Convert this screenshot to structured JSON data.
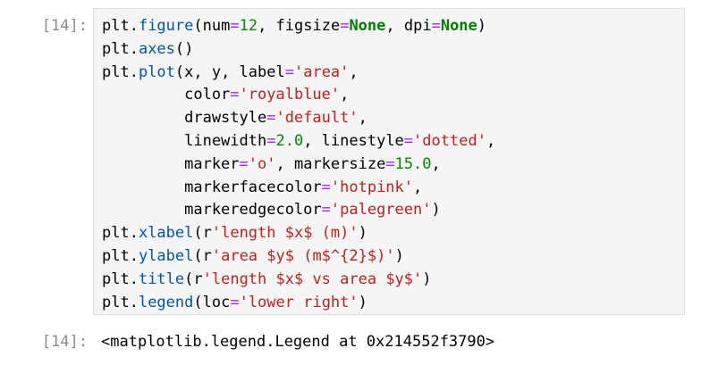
{
  "cell": {
    "input_prompt": "[14]:",
    "output_prompt": "[14]:",
    "output_text": "<matplotlib.legend.Legend at 0x214552f3790>",
    "code_lines": [
      [
        {
          "t": "plt.",
          "c": ""
        },
        {
          "t": "figure",
          "c": "k-func"
        },
        {
          "t": "(num",
          "c": ""
        },
        {
          "t": "=",
          "c": "k-op"
        },
        {
          "t": "12",
          "c": "k-num"
        },
        {
          "t": ", figsize",
          "c": ""
        },
        {
          "t": "=",
          "c": "k-op"
        },
        {
          "t": "None",
          "c": "k-kw"
        },
        {
          "t": ", dpi",
          "c": ""
        },
        {
          "t": "=",
          "c": "k-op"
        },
        {
          "t": "None",
          "c": "k-kw"
        },
        {
          "t": ")",
          "c": ""
        }
      ],
      [
        {
          "t": "plt.",
          "c": ""
        },
        {
          "t": "axes",
          "c": "k-func"
        },
        {
          "t": "()",
          "c": ""
        }
      ],
      [
        {
          "t": "plt.",
          "c": ""
        },
        {
          "t": "plot",
          "c": "k-func"
        },
        {
          "t": "(x, y, label",
          "c": ""
        },
        {
          "t": "=",
          "c": "k-op"
        },
        {
          "t": "'area'",
          "c": "k-str"
        },
        {
          "t": ",",
          "c": ""
        }
      ],
      [
        {
          "t": "         color",
          "c": ""
        },
        {
          "t": "=",
          "c": "k-op"
        },
        {
          "t": "'royalblue'",
          "c": "k-str"
        },
        {
          "t": ",",
          "c": ""
        }
      ],
      [
        {
          "t": "         drawstyle",
          "c": ""
        },
        {
          "t": "=",
          "c": "k-op"
        },
        {
          "t": "'default'",
          "c": "k-str"
        },
        {
          "t": ",",
          "c": ""
        }
      ],
      [
        {
          "t": "         linewidth",
          "c": ""
        },
        {
          "t": "=",
          "c": "k-op"
        },
        {
          "t": "2.0",
          "c": "k-num"
        },
        {
          "t": ", linestyle",
          "c": ""
        },
        {
          "t": "=",
          "c": "k-op"
        },
        {
          "t": "'dotted'",
          "c": "k-str"
        },
        {
          "t": ",",
          "c": ""
        }
      ],
      [
        {
          "t": "         marker",
          "c": ""
        },
        {
          "t": "=",
          "c": "k-op"
        },
        {
          "t": "'o'",
          "c": "k-str"
        },
        {
          "t": ", markersize",
          "c": ""
        },
        {
          "t": "=",
          "c": "k-op"
        },
        {
          "t": "15.0",
          "c": "k-num"
        },
        {
          "t": ",",
          "c": ""
        }
      ],
      [
        {
          "t": "         markerfacecolor",
          "c": ""
        },
        {
          "t": "=",
          "c": "k-op"
        },
        {
          "t": "'hotpink'",
          "c": "k-str"
        },
        {
          "t": ",",
          "c": ""
        }
      ],
      [
        {
          "t": "         markeredgecolor",
          "c": ""
        },
        {
          "t": "=",
          "c": "k-op"
        },
        {
          "t": "'palegreen'",
          "c": "k-str"
        },
        {
          "t": ")",
          "c": ""
        }
      ],
      [
        {
          "t": "plt.",
          "c": ""
        },
        {
          "t": "xlabel",
          "c": "k-func"
        },
        {
          "t": "(r",
          "c": ""
        },
        {
          "t": "'length $x$ (m)'",
          "c": "k-str"
        },
        {
          "t": ")",
          "c": ""
        }
      ],
      [
        {
          "t": "plt.",
          "c": ""
        },
        {
          "t": "ylabel",
          "c": "k-func"
        },
        {
          "t": "(r",
          "c": ""
        },
        {
          "t": "'area $y$ (m$^{2}$)'",
          "c": "k-str"
        },
        {
          "t": ")",
          "c": ""
        }
      ],
      [
        {
          "t": "plt.",
          "c": ""
        },
        {
          "t": "title",
          "c": "k-func"
        },
        {
          "t": "(r",
          "c": ""
        },
        {
          "t": "'length $x$ vs area $y$'",
          "c": "k-str"
        },
        {
          "t": ")",
          "c": ""
        }
      ],
      [
        {
          "t": "plt.",
          "c": ""
        },
        {
          "t": "legend",
          "c": "k-func"
        },
        {
          "t": "(loc",
          "c": ""
        },
        {
          "t": "=",
          "c": "k-op"
        },
        {
          "t": "'lower right'",
          "c": "k-str"
        },
        {
          "t": ")",
          "c": ""
        }
      ]
    ]
  }
}
